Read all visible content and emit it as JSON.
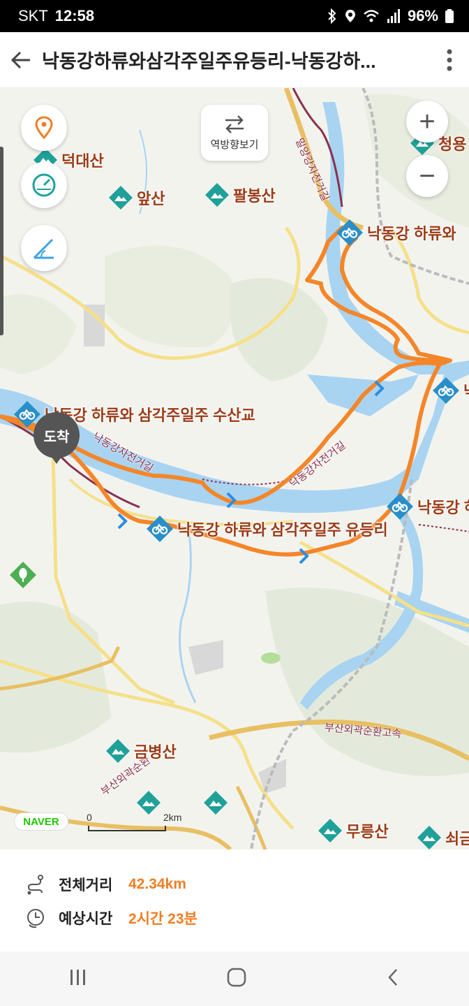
{
  "status_bar": {
    "carrier": "SKT",
    "time": "12:58",
    "battery": "96%"
  },
  "app_bar": {
    "title": "낙동강하류와삼각주일주유등리-낙동강하..."
  },
  "map_controls": {
    "reverse_label": "역방향보기",
    "zoom_in": "+",
    "zoom_out": "−"
  },
  "pois": {
    "deokdaesan": "덕대산",
    "apsan": "앞산",
    "palbongsan": "팔봉산",
    "cheongyong": "청용",
    "nakdong_upper": "낙동강 하류와",
    "suspension": "낙동강 하류와 삼각주일주 수산교",
    "nakdong_right_top": "낙",
    "nakdong_right_mid": "낙동강 하",
    "yudeungri": "낙동강 하류와 삼각주일주 유등리",
    "geumbyeongsan": "금병산",
    "mureungsan": "무릉산",
    "soegeum": "쇠금"
  },
  "road_labels": {
    "miryang_bike": "밀양강자전거길",
    "nakdong_bike_1": "낙동강자전거길",
    "nakdong_bike_2": "낙동강자전거길",
    "busan_ring": "부산외곽순환고속",
    "busan_ring_2": "부산외곽순환"
  },
  "arrival_marker": "도착",
  "attribution": {
    "logo": "NAVER",
    "scale_start": "0",
    "scale_end": "2km"
  },
  "summary": {
    "distance_label": "전체거리",
    "distance_value": "42.34km",
    "time_label": "예상시간",
    "time_value": "2시간 23분"
  },
  "colors": {
    "route": "#f4862a",
    "river": "#a8d4f2",
    "poi_text": "#9b3b16",
    "accent_value": "#f07e24",
    "poi_icon": "#1fa19a"
  },
  "icons": [
    "back-arrow-icon",
    "more-vert-icon",
    "location-pin-icon",
    "speedometer-icon",
    "slope-icon",
    "swap-arrows-icon",
    "mountain-icon",
    "bike-icon",
    "route-distance-icon",
    "clock-icon"
  ]
}
